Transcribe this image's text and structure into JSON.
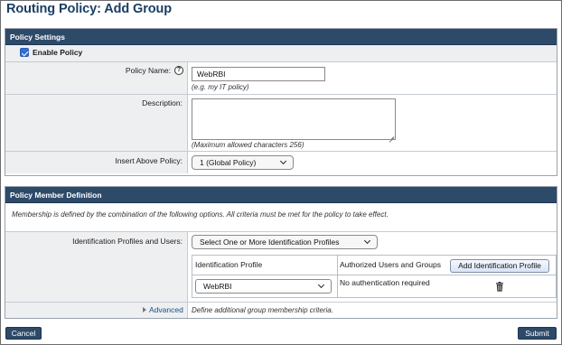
{
  "page": {
    "title": "Routing Policy: Add Group"
  },
  "settings": {
    "header": "Policy Settings",
    "enable_label": "Enable Policy",
    "enable_checked": true,
    "name_label": "Policy Name:",
    "help_glyph": "?",
    "name_value": "WebRBI",
    "name_hint": "(e.g. my IT policy)",
    "description_label": "Description:",
    "description_value": "",
    "description_hint": "(Maximum allowed characters 256)",
    "insert_label": "Insert Above Policy:",
    "insert_value": "1 (Global Policy)"
  },
  "members": {
    "header": "Policy Member Definition",
    "membership_text": "Membership is defined by the combination of the following options. All criteria must be met for the policy to take effect.",
    "id_label": "Identification Profiles and Users:",
    "id_select_value": "Select One or More Identification Profiles",
    "table": {
      "col_profile": "Identification Profile",
      "col_users": "Authorized Users and Groups",
      "add_button": "Add Identification Profile",
      "row_profile": "WebRBI",
      "row_users": "No authentication required"
    },
    "advanced_label": "Advanced",
    "advanced_desc": "Define additional group membership criteria."
  },
  "footer": {
    "cancel_label": "Cancel",
    "submit_label": "Submit"
  },
  "icons": {
    "help": "help-circle-icon",
    "trash": "trash-icon",
    "chevron": "chevron-down-icon",
    "expand": "triangle-right-icon"
  },
  "colors": {
    "header_bg": "#2e4a69",
    "title": "#1b3d63",
    "checkbox": "#2f6fd6"
  }
}
